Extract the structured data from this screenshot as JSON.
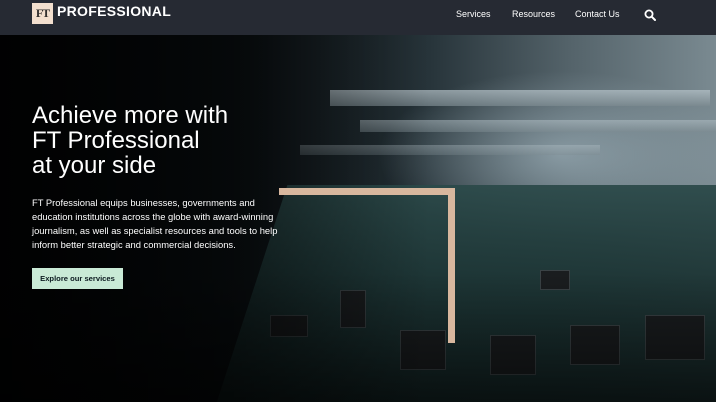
{
  "header": {
    "logo_mark": "FT",
    "logo_text": "PROFESSIONAL",
    "nav": [
      {
        "label": "Services"
      },
      {
        "label": "Resources"
      },
      {
        "label": "Contact Us"
      }
    ],
    "search_icon": "search-icon"
  },
  "hero": {
    "title_lines": [
      "Achieve more with",
      "FT Professional",
      "at your side"
    ],
    "description": "FT Professional equips businesses, governments and education institutions across the globe with award-winning journalism, as well as specialist resources and tools to help inform better strategic and commercial decisions.",
    "cta_label": "Explore our services",
    "colors": {
      "header_bg": "#262a33",
      "logo_bg": "#f2dfce",
      "cta_bg": "#c9ead6",
      "frame_accent": "#d8b79e"
    }
  }
}
